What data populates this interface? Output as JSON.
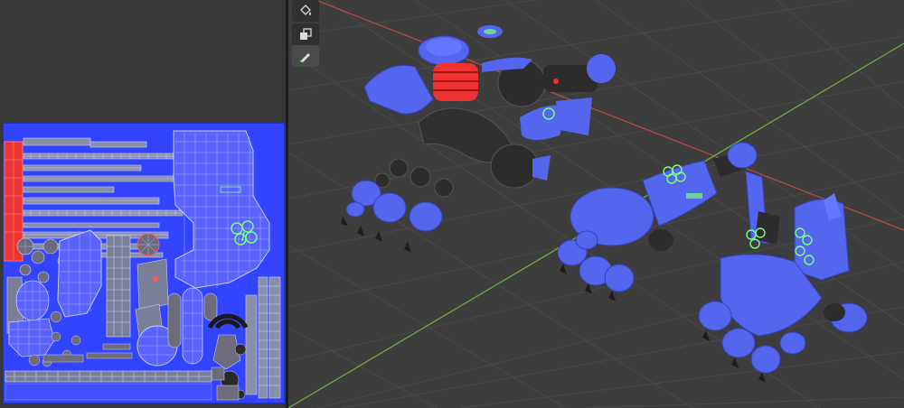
{
  "app": "Blender",
  "panels": {
    "left": "uv-editor",
    "right": "3d-viewport"
  },
  "colors": {
    "uv_sheet": "#3344ff",
    "uv_wire": "#9aa0ff",
    "mesh_blue": "#5566ee",
    "mesh_red": "#ee3333",
    "mesh_dark": "#2c2c2c",
    "emblem_green": "#7dff7d",
    "axis_red": "#b34a4a",
    "axis_green": "#6fa83f",
    "grid": "#4a4a4a"
  },
  "tools": [
    {
      "name": "paint-bucket-icon",
      "active": false
    },
    {
      "name": "clone-icon",
      "active": false
    },
    {
      "name": "brush-icon",
      "active": true
    }
  ]
}
